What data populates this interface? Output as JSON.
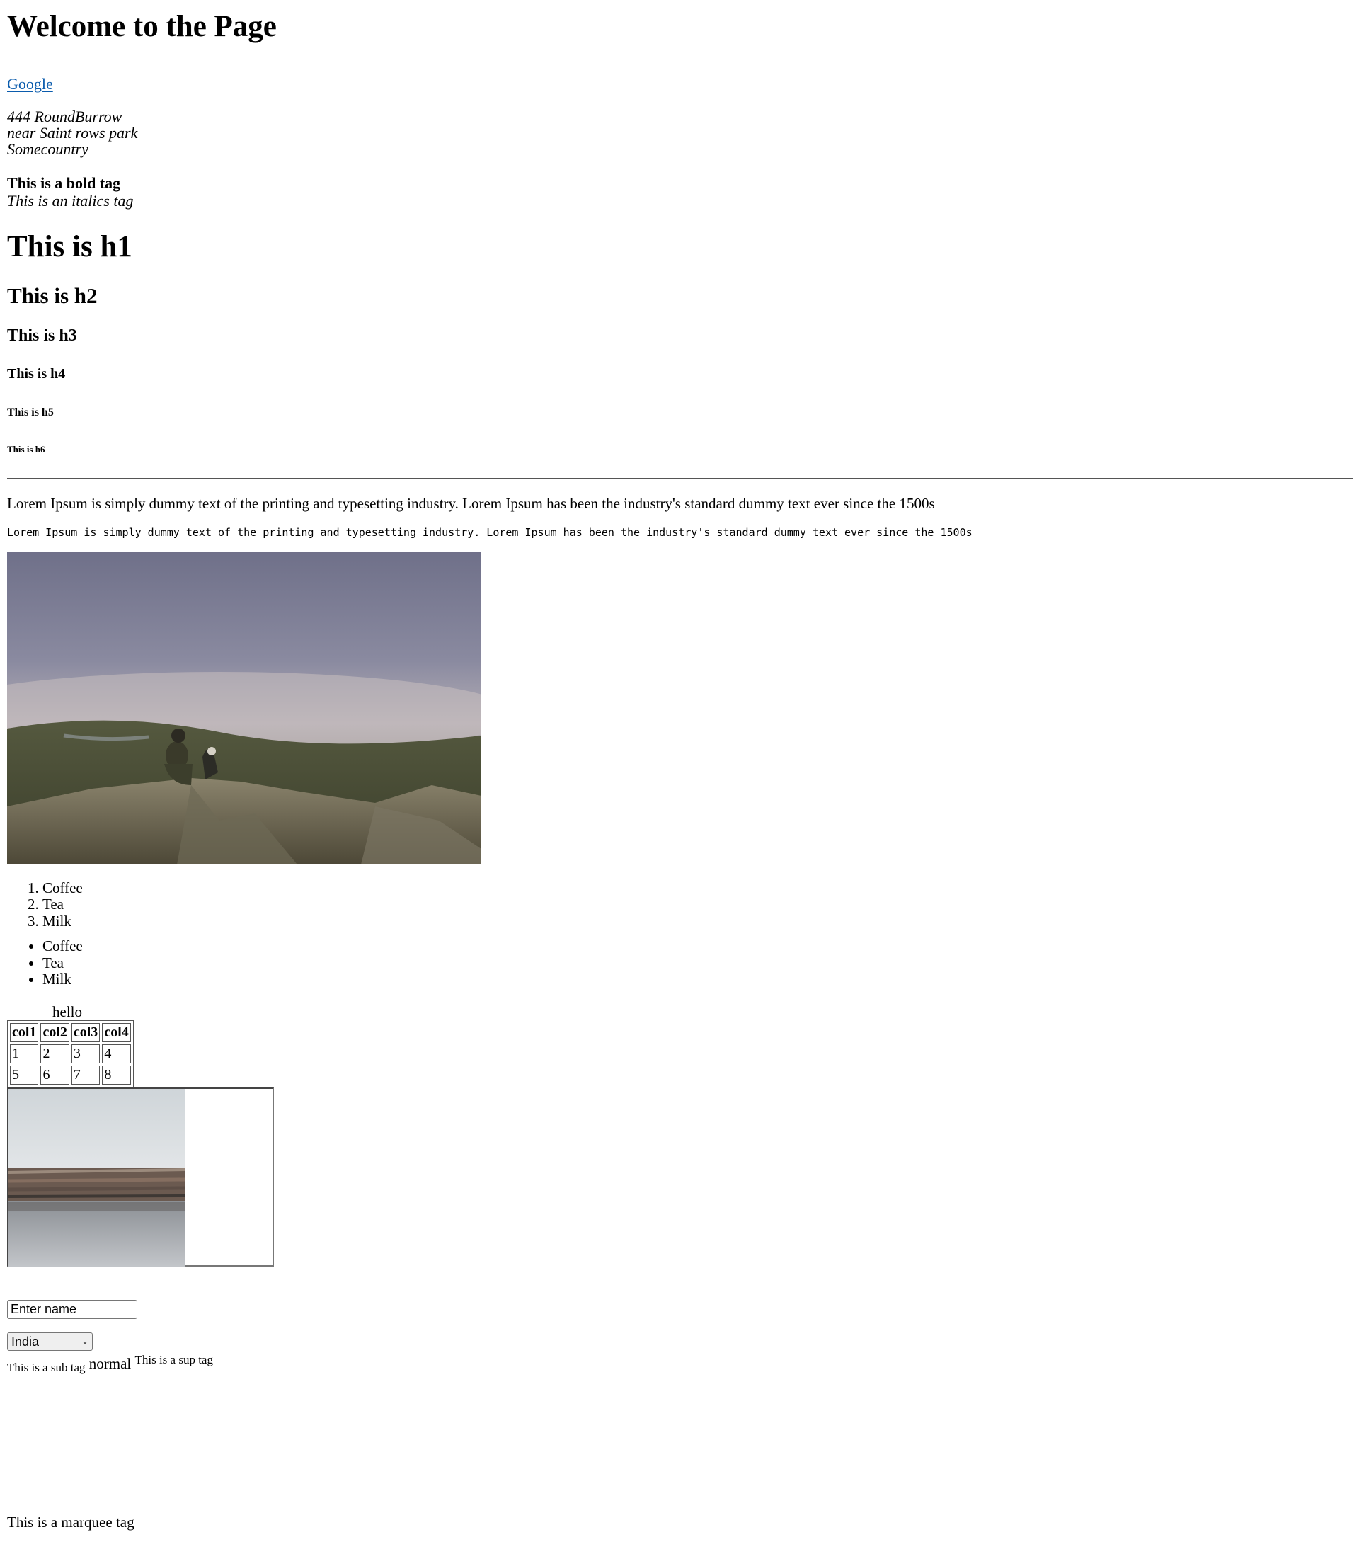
{
  "page": {
    "welcome": "Welcome to the Page",
    "link": "Google",
    "address": [
      "444 RoundBurrow",
      "near Saint rows park",
      "Somecountry"
    ],
    "bold_text": "This is a bold tag",
    "italic_text": "This is an italics tag",
    "headings": {
      "h1": "This is h1",
      "h2": "This is h2",
      "h3": "This is h3",
      "h4": "This is h4",
      "h5": "This is h5",
      "h6": "This is h6"
    },
    "paragraph": "Lorem Ipsum is simply dummy text of the printing and typesetting industry. Lorem Ipsum has been the industry's standard dummy text ever since the 1500s",
    "preformatted": "Lorem Ipsum is simply dummy text of the printing and typesetting industry. Lorem Ipsum has been the industry's standard dummy text ever since the 1500s",
    "ordered_list": [
      "Coffee",
      "Tea",
      "Milk"
    ],
    "unordered_list": [
      "Coffee",
      "Tea",
      "Milk"
    ],
    "table": {
      "caption": "hello",
      "headers": [
        "col1",
        "col2",
        "col3",
        "col4"
      ],
      "rows": [
        [
          "1",
          "2",
          "3",
          "4"
        ],
        [
          "5",
          "6",
          "7",
          "8"
        ]
      ]
    },
    "name_input": {
      "value": "",
      "placeholder": "Enter name"
    },
    "country_select": {
      "selected": "India"
    },
    "sub_text": "This is a sub tag",
    "normal_text": "normal",
    "sup_text": "This is a sup tag",
    "marquee_text": "This is a marquee tag"
  }
}
